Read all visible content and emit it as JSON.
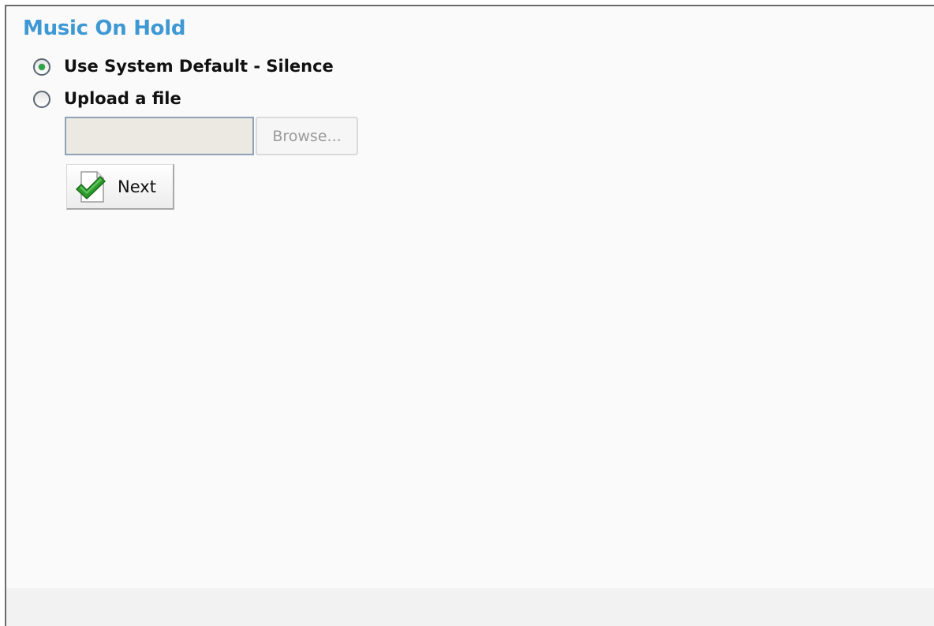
{
  "page": {
    "title": "Music On Hold"
  },
  "options": [
    {
      "label": "Use System Default - Silence",
      "selected": true
    },
    {
      "label": "Upload a file",
      "selected": false
    }
  ],
  "upload": {
    "file_value": "",
    "browse_label": "Browse...",
    "enabled": false
  },
  "actions": {
    "next_label": "Next",
    "next_icon": "checkmark-document-icon"
  },
  "colors": {
    "title": "#3d98d3",
    "radio_selected": "#2fa34a",
    "checkmark": "#2e9a2e"
  }
}
